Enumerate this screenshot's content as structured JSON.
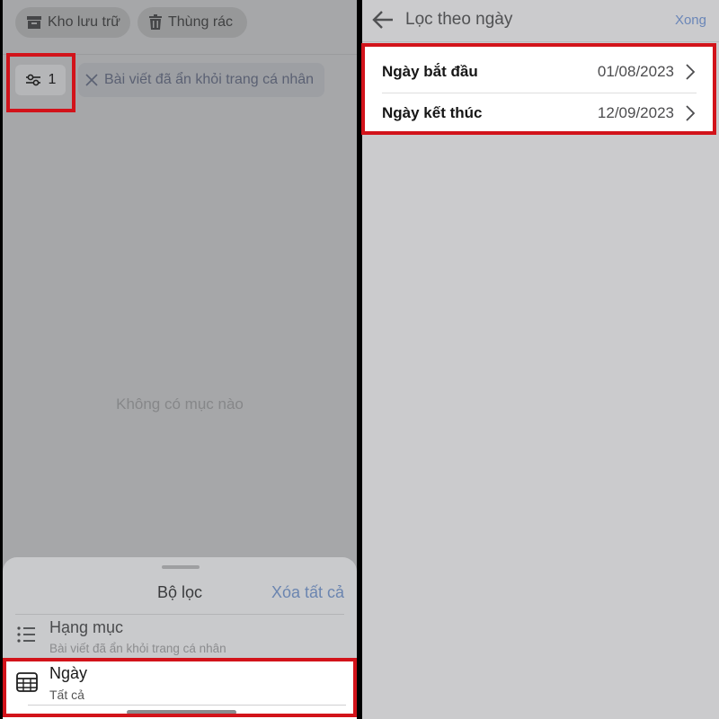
{
  "left": {
    "archive_label": "Kho lưu trữ",
    "trash_label": "Thùng rác",
    "filter_count": "1",
    "active_filter": "Bài viết đã ẩn khỏi trang cá nhân",
    "empty_message": "Không có mục nào",
    "sheet": {
      "title": "Bộ lọc",
      "clear_all": "Xóa tất cả",
      "category": {
        "title": "Hạng mục",
        "value": "Bài viết đã ẩn khỏi trang cá nhân",
        "icon": "list-icon"
      },
      "date": {
        "title": "Ngày",
        "value": "Tất cả",
        "icon": "calendar-icon"
      }
    }
  },
  "right": {
    "title": "Lọc theo ngày",
    "done": "Xong",
    "rows": [
      {
        "label": "Ngày bắt đầu",
        "value": "01/08/2023"
      },
      {
        "label": "Ngày kết thúc",
        "value": "12/09/2023"
      }
    ]
  },
  "colors": {
    "highlight": "#d2131a",
    "link": "#6b85b0",
    "overlay": "#a6a7a9"
  }
}
